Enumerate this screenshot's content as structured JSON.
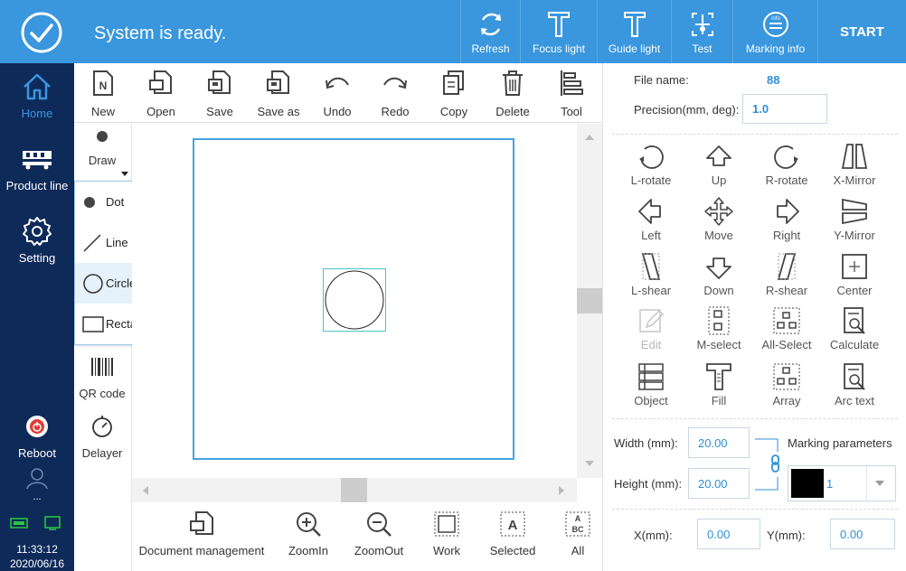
{
  "topbar": {
    "status": "System is ready.",
    "buttons": [
      {
        "label": "Refresh",
        "icon": "refresh-icon"
      },
      {
        "label": "Focus light",
        "icon": "focus-light-icon"
      },
      {
        "label": "Guide light",
        "icon": "guide-light-icon"
      },
      {
        "label": "Test",
        "icon": "test-icon"
      },
      {
        "label": "Marking info",
        "icon": "marking-info-icon"
      }
    ],
    "start_label": "START",
    "colors": {
      "bar": "#3a96dd",
      "sidebar": "#0e2a59"
    }
  },
  "sidebar": {
    "items": [
      {
        "label": "Home",
        "icon": "home-icon"
      },
      {
        "label": "Product line",
        "icon": "product-line-icon"
      },
      {
        "label": "Setting",
        "icon": "gear-icon"
      },
      {
        "label": "Reboot",
        "icon": "reboot-icon"
      },
      {
        "label": "...",
        "icon": "user-icon"
      }
    ],
    "time": "11:33:12",
    "date": "2020/06/16"
  },
  "toolbar": {
    "items": [
      {
        "label": "New",
        "icon": "new-file-icon"
      },
      {
        "label": "Open",
        "icon": "open-file-icon"
      },
      {
        "label": "Save",
        "icon": "save-icon"
      },
      {
        "label": "Save as",
        "icon": "save-as-icon"
      },
      {
        "label": "Undo",
        "icon": "undo-icon"
      },
      {
        "label": "Redo",
        "icon": "redo-icon"
      },
      {
        "label": "Copy",
        "icon": "copy-icon"
      },
      {
        "label": "Delete",
        "icon": "trash-icon"
      },
      {
        "label": "Tool",
        "icon": "tool-icon"
      }
    ]
  },
  "toolcol": {
    "draw": "Draw",
    "qrcode": "QR code",
    "delayer": "Delayer"
  },
  "draw_menu": {
    "items": [
      {
        "label": "Dot"
      },
      {
        "label": "Line"
      },
      {
        "label": "Circle",
        "selected": true
      },
      {
        "label": "Rectangle"
      }
    ]
  },
  "bottombar": {
    "items": [
      {
        "label": "Document management",
        "icon": "folder-icon"
      },
      {
        "label": "ZoomIn",
        "icon": "zoom-in-icon"
      },
      {
        "label": "ZoomOut",
        "icon": "zoom-out-icon"
      },
      {
        "label": "Work",
        "icon": "work-area-icon"
      },
      {
        "label": "Selected",
        "icon": "selected-icon"
      },
      {
        "label": "All",
        "icon": "all-icon"
      }
    ]
  },
  "rightpanel": {
    "file_name_label": "File name:",
    "file_name": "88",
    "precision_label": "Precision(mm, deg):",
    "precision": "1.0",
    "tools": [
      {
        "label": "L-rotate"
      },
      {
        "label": "Up"
      },
      {
        "label": "R-rotate"
      },
      {
        "label": "X-Mirror"
      },
      {
        "label": "Left"
      },
      {
        "label": "Move"
      },
      {
        "label": "Right"
      },
      {
        "label": "Y-Mirror"
      },
      {
        "label": "L-shear"
      },
      {
        "label": "Down"
      },
      {
        "label": "R-shear"
      },
      {
        "label": "Center"
      },
      {
        "label": "Edit",
        "disabled": true
      },
      {
        "label": "M-select"
      },
      {
        "label": "All-Select"
      },
      {
        "label": "Calculate"
      },
      {
        "label": "Object"
      },
      {
        "label": "Fill"
      },
      {
        "label": "Array"
      },
      {
        "label": "Arc text"
      }
    ],
    "width_label": "Width (mm):",
    "width": "20.00",
    "height_label": "Height (mm):",
    "height": "20.00",
    "marking_params_label": "Marking parameters",
    "marking_param_value": "1",
    "marking_color": "#000000",
    "x_label": "X(mm):",
    "x": "0.00",
    "y_label": "Y(mm):",
    "y": "0.00"
  }
}
